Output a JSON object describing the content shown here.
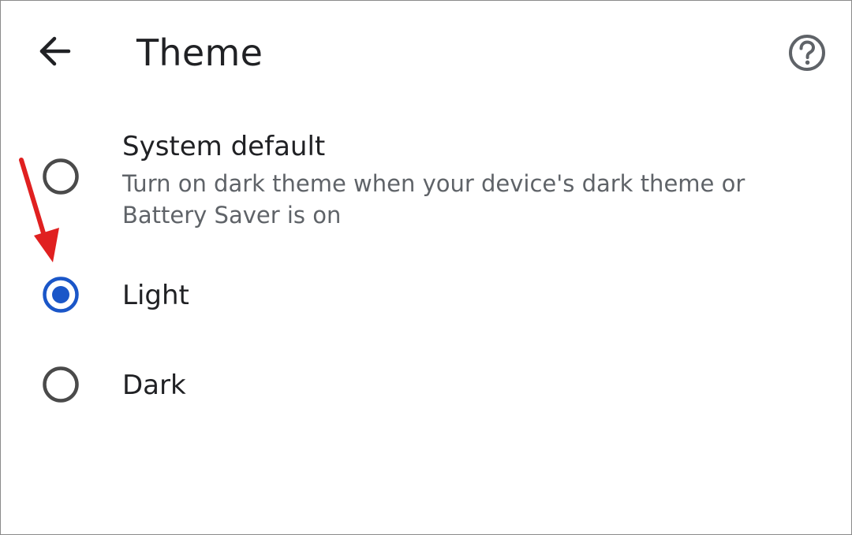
{
  "header": {
    "title": "Theme",
    "back_icon": "arrow-back-icon",
    "help_icon": "help-circle-icon"
  },
  "options": [
    {
      "label": "System default",
      "description_line1": "Turn on dark theme when your device's dark theme or",
      "description_line2": "Battery Saver is on",
      "selected": false
    },
    {
      "label": "Light",
      "selected": true
    },
    {
      "label": "Dark",
      "selected": false
    }
  ],
  "colors": {
    "accent": "#1a56c8",
    "unselected_radio": "#4a4a4a",
    "annotation_arrow": "#e02020"
  }
}
